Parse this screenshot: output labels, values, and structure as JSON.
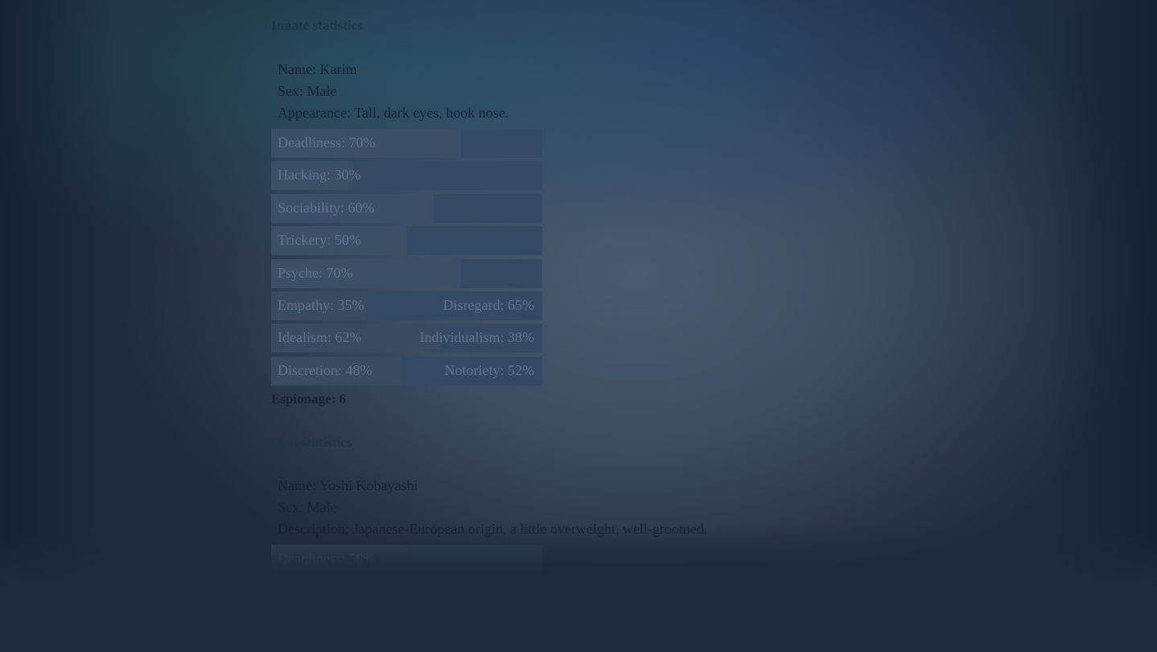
{
  "innate": {
    "title": "Innate statistics",
    "name": "Name: Karim",
    "sex": "Sex: Male",
    "appearance": "Appearance: Tall, dark eyes, hook nose.",
    "bars": [
      {
        "label": "Deadliness: 70%",
        "value": 70
      },
      {
        "label": "Hacking: 30%",
        "value": 30
      },
      {
        "label": "Sociability: 60%",
        "value": 60
      },
      {
        "label": "Trickery: 50%",
        "value": 50
      },
      {
        "label": "Psyche: 70%",
        "value": 70
      }
    ],
    "dual_bars": [
      {
        "left_label": "Empathy: 35%",
        "right_label": "Disregard: 65%",
        "value": 35
      },
      {
        "left_label": "Idealism: 62%",
        "right_label": "Individualism: 38%",
        "value": 62
      },
      {
        "left_label": "Discretion: 48%",
        "right_label": "Notoriety: 52%",
        "value": 48
      }
    ],
    "skill": "Espionage: 6"
  },
  "host": {
    "title": "Host statistics",
    "name": "Name: Yoshi Kobayashi",
    "sex": "Sex: Male",
    "description": "Description: Japanese-European origin, a little overweight, well-groomed.",
    "bars": [
      {
        "label": "Deadliness: 50%",
        "value": 50
      }
    ]
  },
  "colors": {
    "bar_bg": "#344a64",
    "bar_fill": "#3d4f66",
    "bar_text": "#5f7590",
    "text_dark": "#152233"
  }
}
